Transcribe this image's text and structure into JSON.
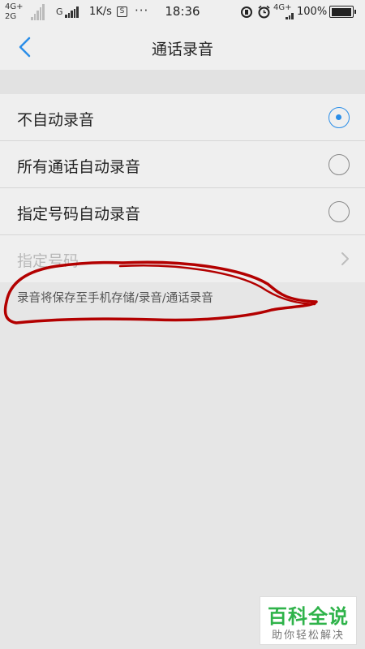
{
  "status_bar": {
    "net1_top": "4G+",
    "net1_bottom": "2G",
    "net2": "G",
    "speed": "1K/s",
    "time": "18:36",
    "net3": "4G+",
    "battery_text": "100%",
    "battery_level": 1.0,
    "icons": [
      "signal-icon",
      "sim-icon",
      "more-icon",
      "rotation-lock-icon",
      "alarm-icon",
      "battery-icon"
    ]
  },
  "nav": {
    "back_icon": "chevron-left-icon",
    "title": "通话录音"
  },
  "options": [
    {
      "label": "不自动录音",
      "selected": true
    },
    {
      "label": "所有通话自动录音",
      "selected": false
    },
    {
      "label": "指定号码自动录音",
      "selected": false
    }
  ],
  "specified_numbers": {
    "label": "指定号码",
    "enabled": false
  },
  "note": "录音将保存至手机存储/录音/通话录音",
  "watermark": {
    "title": "百科全说",
    "subtitle": "助你轻松解决"
  },
  "colors": {
    "accent": "#2b8ee8",
    "annotation": "#b30000",
    "watermark_green": "#2fb34a"
  }
}
